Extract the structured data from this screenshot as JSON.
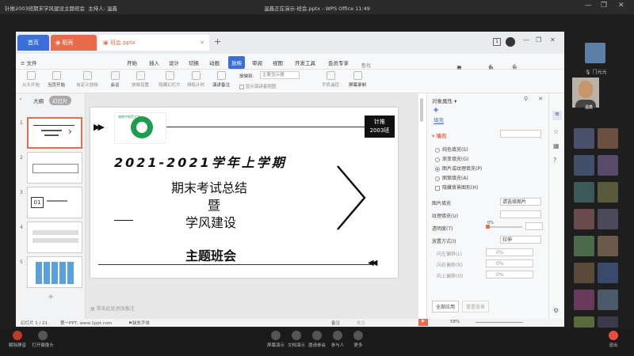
{
  "meeting": {
    "title": "针推2003班期末学风建设主题班会",
    "host": "主持人: 温鑫",
    "presenting": "温鑫正在演示-班会.pptx - WPS Office 11:49"
  },
  "wps": {
    "tabs": [
      "首页",
      "稻壳",
      "班会.pptx"
    ],
    "menu": [
      "≡ 文件",
      "开始",
      "插入",
      "设计",
      "切换",
      "动画",
      "放映",
      "审阅",
      "视图",
      "开发工具",
      "会员专享"
    ],
    "active_menu": "放映",
    "search": "查找命令、搜索模板",
    "right_menu": [
      "有修改",
      "协作",
      "分享"
    ],
    "ribbon": [
      "从头开始",
      "当页开始",
      "自定义放映",
      "会议",
      "放映设置",
      "隐藏幻灯片",
      "排练计时",
      "演讲备注",
      "放映到:",
      "主要显示器",
      "显示演讲者视图",
      "手机遥控",
      "屏幕录制"
    ],
    "left_tabs": [
      "大纲",
      "幻灯片"
    ],
    "slide_count": "幻灯片 1 / 21",
    "slide_meta": "第一PPT, www.1ppt.com",
    "missing_font": "缺失字体",
    "notes_placeholder": "单击此处添加备注",
    "zoom": "58%",
    "status_right": [
      "备注",
      "批注"
    ]
  },
  "slide": {
    "badge_line1": "针推",
    "badge_line2": "2003班",
    "year": "2021-2021学年上学期",
    "line1": "期末考试总结",
    "line2": "暨",
    "line3": "学风建设",
    "subtitle": "主题班会",
    "logo_text": "湖南中医药大学"
  },
  "thumbs": [
    "1",
    "2",
    "3",
    "4",
    "5"
  ],
  "thumb3_text": "01",
  "property_panel": {
    "title": "对象属性 ▾",
    "tab": "填充",
    "section": "填充",
    "options": [
      "纯色填充(S)",
      "渐变填充(G)",
      "图片或纹理填充(P)",
      "图案填充(A)",
      "隐藏背景图形(H)"
    ],
    "selected_option": 2,
    "image_fill_label": "图片填充",
    "image_fill_value": "请选择图片",
    "texture_label": "纹理填充(U)",
    "transparency_label": "透明度(T)",
    "transparency_value": "0%",
    "placement_label": "放置方式(I)",
    "placement_value": "拉伸",
    "offsets": [
      {
        "label": "向左偏移(L)",
        "value": "0%"
      },
      {
        "label": "向右偏移(R)",
        "value": "0%"
      },
      {
        "label": "向上偏移(O)",
        "value": "0%"
      }
    ],
    "apply_all": "全部应用",
    "reset": "重置背景"
  },
  "participants": {
    "host_name": "温鑫",
    "top_name": "门元元",
    "mic_label": "门元元"
  },
  "bottom": {
    "left": [
      "解除静音",
      "打开摄像头"
    ],
    "center": [
      "屏幕演示",
      "文档演示",
      "邀请参会",
      "参与人",
      "更多"
    ],
    "leave": "退出"
  }
}
